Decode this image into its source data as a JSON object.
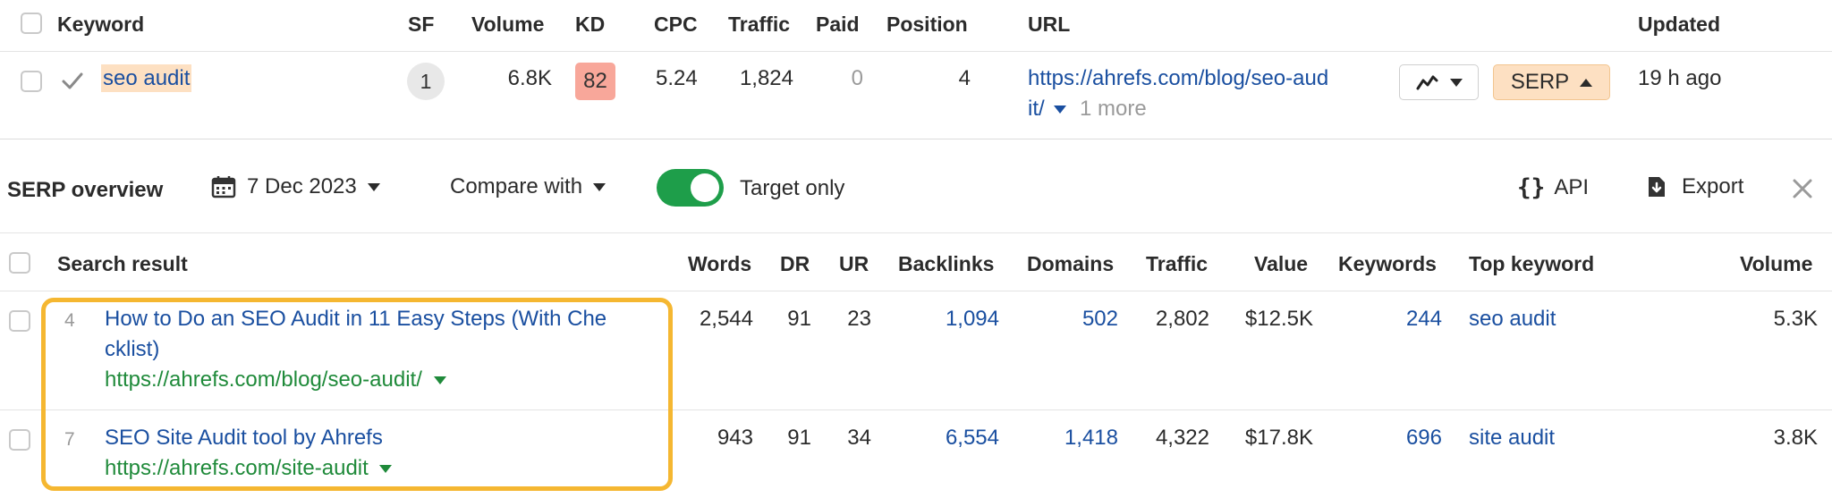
{
  "colors": {
    "kd_badge": "#f8a79a",
    "keyword_highlight": "#fde0c2",
    "serp_button_bg": "#fde0c2",
    "toggle_on": "#1e9e4a",
    "highlight_border": "#f5b731",
    "link": "#1a4fa0",
    "url_green": "#1f8a3a"
  },
  "keyword_table": {
    "headers": {
      "keyword": "Keyword",
      "sf": "SF",
      "volume": "Volume",
      "kd": "KD",
      "cpc": "CPC",
      "traffic": "Traffic",
      "paid": "Paid",
      "position": "Position",
      "url": "URL",
      "updated": "Updated"
    },
    "row": {
      "keyword": "seo audit",
      "sf": "1",
      "volume": "6.8K",
      "kd": "82",
      "cpc": "5.24",
      "traffic": "1,824",
      "paid": "0",
      "position": "4",
      "url_line1": "https://ahrefs.com/blog/seo-aud",
      "url_line2": "it/",
      "more": "1 more",
      "serp_button": "SERP",
      "updated": "19 h ago",
      "check_icon": "check-icon",
      "chart_icon": "trend-chart-icon"
    }
  },
  "toolbar": {
    "title": "SERP overview",
    "date": "7 Dec 2023",
    "compare": "Compare with",
    "toggle_label": "Target only",
    "toggle_on": true,
    "api": "API",
    "export": "Export"
  },
  "serp_table": {
    "headers": {
      "search_result": "Search result",
      "words": "Words",
      "dr": "DR",
      "ur": "UR",
      "backlinks": "Backlinks",
      "domains": "Domains",
      "traffic": "Traffic",
      "value": "Value",
      "keywords": "Keywords",
      "top_keyword": "Top keyword",
      "volume": "Volume"
    },
    "rows": [
      {
        "position": "4",
        "title_line1": "How to Do an SEO Audit in 11 Easy Steps (With Che",
        "title_line2": "cklist)",
        "url": "https://ahrefs.com/blog/seo-audit/",
        "words": "2,544",
        "dr": "91",
        "ur": "23",
        "backlinks": "1,094",
        "domains": "502",
        "traffic": "2,802",
        "value": "$12.5K",
        "keywords": "244",
        "top_keyword": "seo audit",
        "volume": "5.3K"
      },
      {
        "position": "7",
        "title_line1": "SEO Site Audit tool by Ahrefs",
        "url": "https://ahrefs.com/site-audit",
        "words": "943",
        "dr": "91",
        "ur": "34",
        "backlinks": "6,554",
        "domains": "1,418",
        "traffic": "4,322",
        "value": "$17.8K",
        "keywords": "696",
        "top_keyword": "site audit",
        "volume": "3.8K"
      }
    ]
  }
}
